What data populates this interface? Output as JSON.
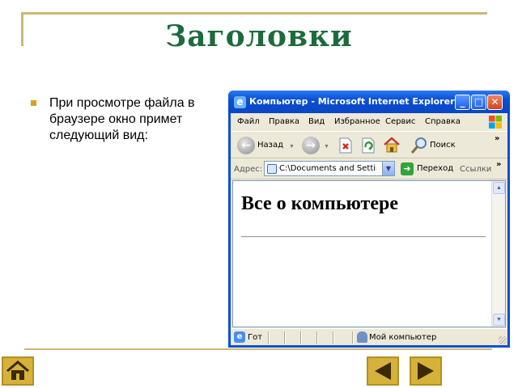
{
  "slide": {
    "title": "Заголовки",
    "bullet_text": "При просмотре файла в браузере окно примет следующий вид:"
  },
  "ie": {
    "window_title": "Компьютер - Microsoft Internet Explorer",
    "menu": [
      "Файл",
      "Правка",
      "Вид",
      "Избранное",
      "Сервис",
      "Справка"
    ],
    "toolbar": {
      "back_label": "Назад",
      "search_label": "Поиск"
    },
    "address": {
      "label": "Адрес:",
      "value": "C:\\Documents and Settings\\",
      "go_label": "Переход",
      "links_label": "Ссылки"
    },
    "page": {
      "heading": "Все о компьютере"
    },
    "status": {
      "text": "Гот",
      "zone": "Мой компьютер"
    }
  },
  "colors": {
    "title_green": "#1d6b3d",
    "frame_gold": "#cdb873",
    "bullet_gold": "#d9a21c",
    "xp_blue": "#0a50d6",
    "button_gold": "#d6b23a"
  },
  "icons": [
    "ie-icon",
    "minimize-icon",
    "maximize-icon",
    "close-icon",
    "windows-logo-icon",
    "back-arrow-icon",
    "forward-arrow-icon",
    "stop-icon",
    "refresh-icon",
    "home-icon",
    "search-icon",
    "page-icon",
    "go-arrow-icon",
    "computer-zone-icon",
    "home-nav-icon",
    "prev-nav-icon",
    "next-nav-icon"
  ]
}
